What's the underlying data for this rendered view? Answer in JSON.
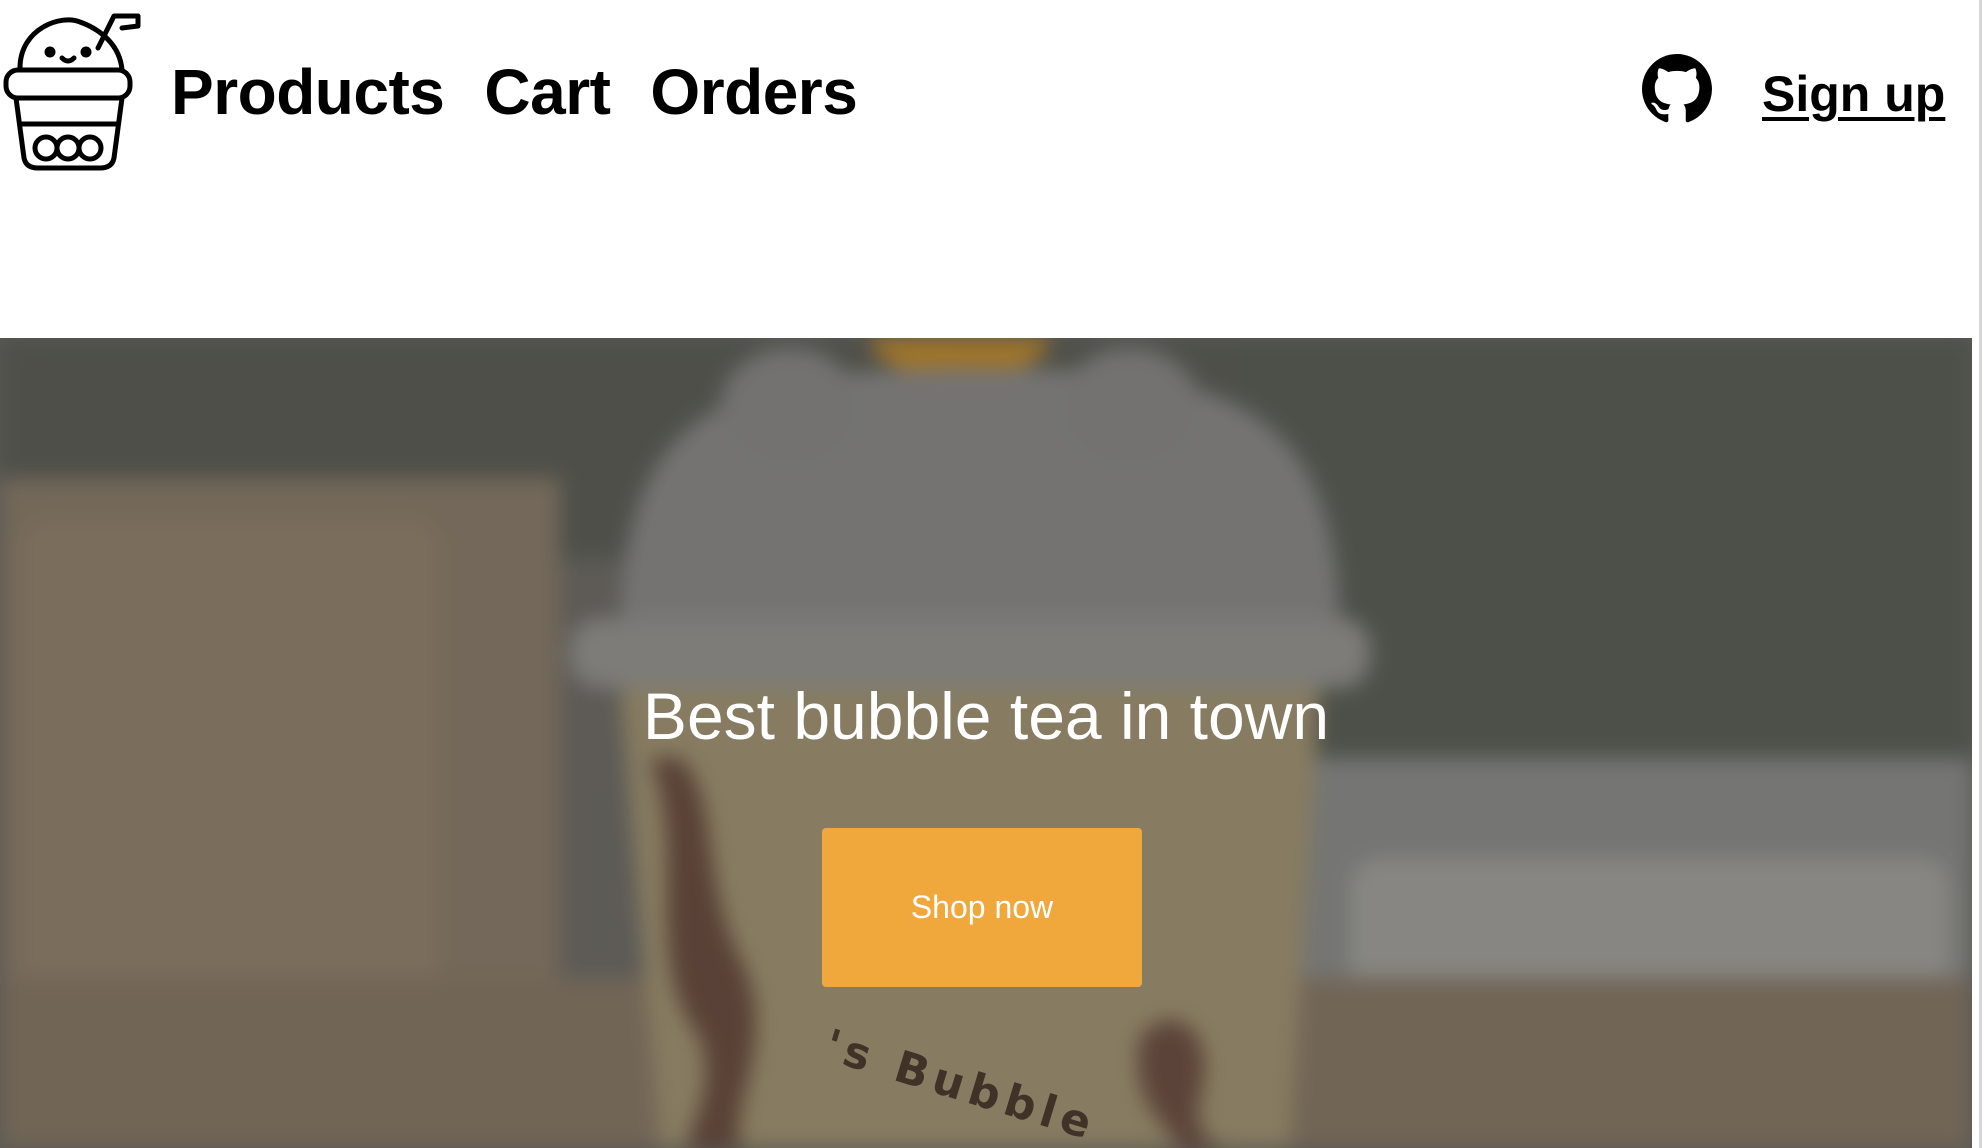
{
  "nav": {
    "logo_icon": "bubble-tea-cup-icon",
    "links": [
      "Products",
      "Cart",
      "Orders"
    ],
    "github_icon": "github-icon",
    "signup_label": "Sign up"
  },
  "hero": {
    "title": "Best bubble tea in town",
    "cta_label": "Shop now",
    "cup_lettering": "'s Bubble"
  },
  "colors": {
    "accent": "#f0a73c",
    "hero_text": "#ffffff",
    "nav_text": "#000000"
  }
}
